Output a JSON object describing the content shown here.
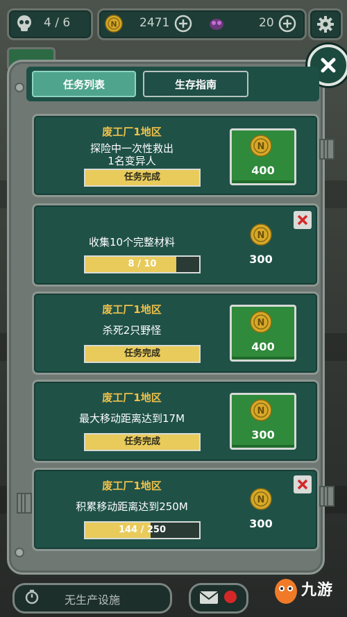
{
  "hud": {
    "players": "4 / 6",
    "coins": "2471",
    "gems": "20"
  },
  "tabs": [
    {
      "label": "任务列表",
      "active": true
    },
    {
      "label": "生存指南",
      "active": false
    }
  ],
  "tasks": [
    {
      "area": "废工厂1地区",
      "desc": "探险中一次性救出",
      "desc2": "1名变异人",
      "progress_text": "任务完成",
      "progress": 1.0,
      "reward": "400",
      "claimable": true
    },
    {
      "area": "",
      "desc": "收集10个完整材料",
      "desc2": "",
      "progress_text": "8 / 10",
      "progress": 0.8,
      "reward": "300",
      "claimable": false
    },
    {
      "area": "废工厂1地区",
      "desc": "杀死2只野怪",
      "desc2": "",
      "progress_text": "任务完成",
      "progress": 1.0,
      "reward": "400",
      "claimable": true
    },
    {
      "area": "废工厂1地区",
      "desc": "最大移动距离达到17M",
      "desc2": "",
      "progress_text": "任务完成",
      "progress": 1.0,
      "reward": "300",
      "claimable": true
    },
    {
      "area": "废工厂1地区",
      "desc": "积累移动距离达到250M",
      "desc2": "",
      "progress_text": "144 / 250",
      "progress": 0.576,
      "reward": "300",
      "claimable": false
    }
  ],
  "bottom": {
    "facility_label": "无生产设施"
  },
  "watermark": {
    "text": "九游"
  },
  "colors": {
    "accent_green": "#2f8a3b",
    "card_bg": "#1f5147",
    "progress_fill": "#e9cb5b",
    "area_text": "#f0c14a",
    "close_red": "#d42828"
  },
  "icons": [
    "skull-icon",
    "coin-icon",
    "plus-icon",
    "gem-icon",
    "gear-icon",
    "close-icon",
    "x-icon",
    "timer-icon",
    "mail-icon"
  ]
}
